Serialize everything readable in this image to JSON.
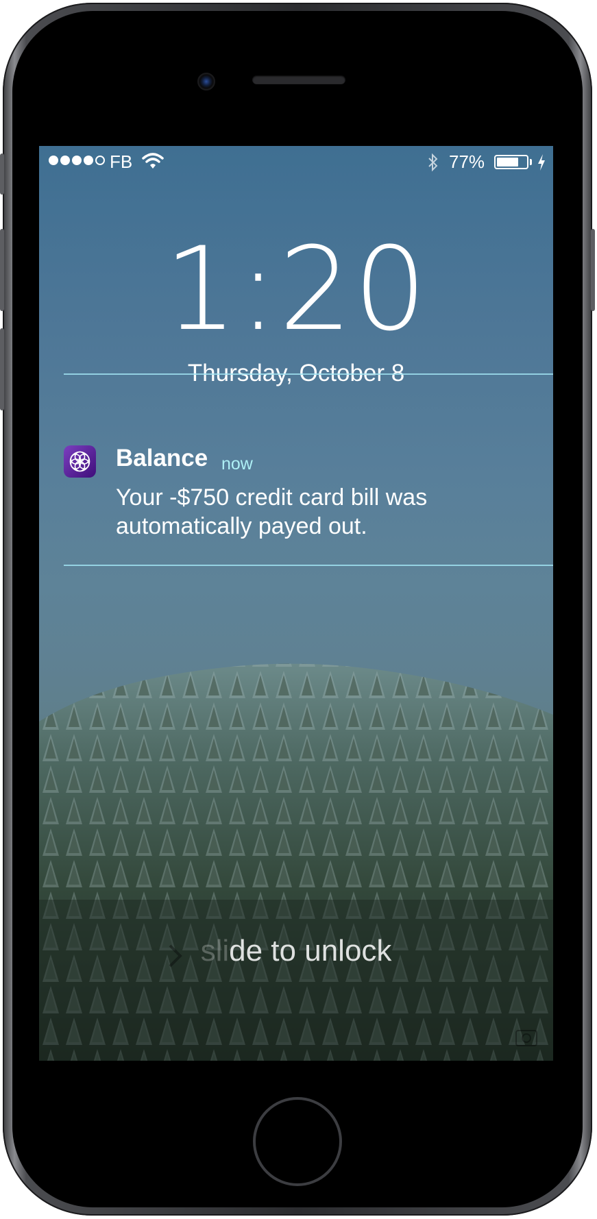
{
  "status_bar": {
    "carrier": "FB",
    "signal_bars_filled": 4,
    "signal_bars_total": 5,
    "battery_percent_label": "77%",
    "battery_level": 0.77,
    "icons": [
      "wifi-icon",
      "bluetooth-icon",
      "battery-icon",
      "charging-bolt-icon"
    ]
  },
  "lock_screen": {
    "time": "1:20",
    "date": "Thursday, October 8",
    "slide_fade": "sli",
    "slide_text": "de to unlock"
  },
  "notification": {
    "app_name": "Balance",
    "time": "now",
    "message": "Your -$750 credit card bill was automatically payed out.",
    "icon": "balance-flower-icon",
    "icon_color": "#5b24a3",
    "accent_color": "#aef0f6"
  }
}
